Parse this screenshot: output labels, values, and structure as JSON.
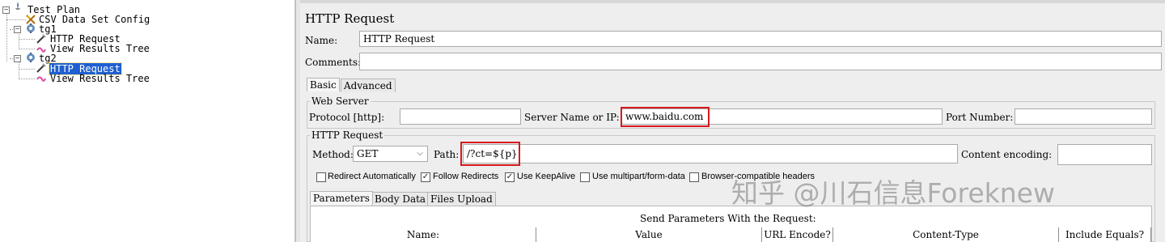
{
  "tree": {
    "items": [
      {
        "label": "Test Plan",
        "icon": "test-plan-icon"
      },
      {
        "label": "CSV Data Set Config",
        "icon": "csv-config-icon"
      },
      {
        "label": "tg1",
        "icon": "thread-group-icon"
      },
      {
        "label": "HTTP Request",
        "icon": "http-sampler-icon"
      },
      {
        "label": "View Results Tree",
        "icon": "listener-icon"
      },
      {
        "label": "tg2",
        "icon": "thread-group-icon"
      },
      {
        "label": "HTTP Request",
        "icon": "http-sampler-icon",
        "selected": true
      },
      {
        "label": "View Results Tree",
        "icon": "listener-icon"
      }
    ]
  },
  "editor": {
    "title": "HTTP Request",
    "name_label": "Name:",
    "name_value": "HTTP Request",
    "comments_label": "Comments:",
    "comments_value": "",
    "tabs": [
      "Basic",
      "Advanced"
    ],
    "web_server": {
      "title": "Web Server",
      "protocol_label": "Protocol [http]:",
      "protocol_value": "",
      "server_label": "Server Name or IP:",
      "server_value": "www.baidu.com",
      "port_label": "Port Number:",
      "port_value": ""
    },
    "http_request": {
      "title": "HTTP Request",
      "method_label": "Method:",
      "method_value": "GET",
      "path_label": "Path:",
      "path_value": "/?ct=${p}",
      "encoding_label": "Content encoding:",
      "encoding_value": ""
    },
    "checkboxes": [
      {
        "label": "Redirect Automatically",
        "checked": false
      },
      {
        "label": "Follow Redirects",
        "checked": true
      },
      {
        "label": "Use KeepAlive",
        "checked": true
      },
      {
        "label": "Use multipart/form-data",
        "checked": false
      },
      {
        "label": "Browser-compatible headers",
        "checked": false
      }
    ],
    "param_tabs": [
      "Parameters",
      "Body Data",
      "Files Upload"
    ],
    "params_caption": "Send Parameters With the Request:",
    "columns": [
      "Name:",
      "Value",
      "URL Encode?",
      "Content-Type",
      "Include Equals?"
    ]
  },
  "watermark": "知乎 @川石信息Foreknew",
  "colors": {
    "highlight_red": "#d7191c",
    "selection_blue": "#1f5fd1"
  }
}
